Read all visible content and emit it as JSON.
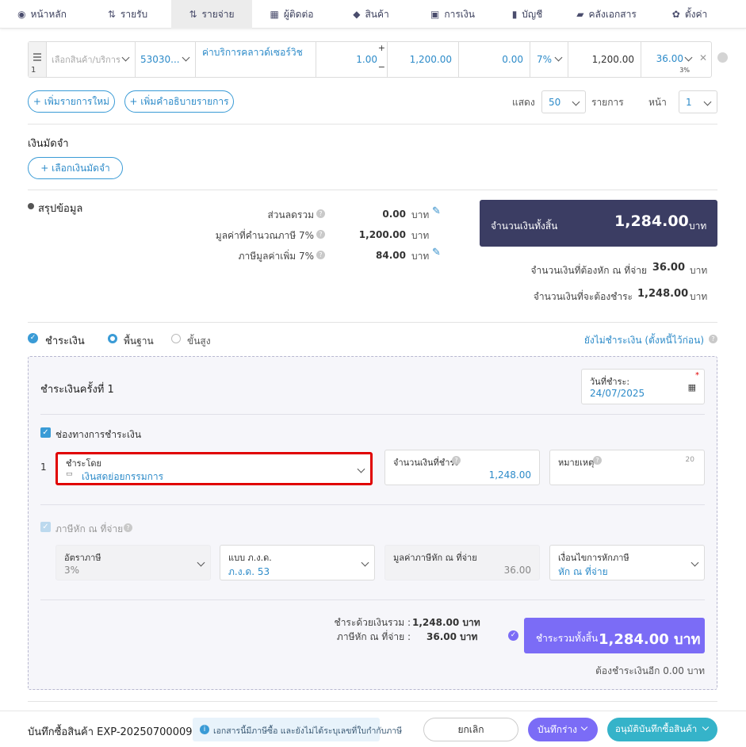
{
  "nav": [
    {
      "label": "หน้าหลัก",
      "icon": "dashboard-icon",
      "glyph": "◉"
    },
    {
      "label": "รายรับ",
      "icon": "income-icon",
      "glyph": "⇅"
    },
    {
      "label": "รายจ่าย",
      "icon": "expense-icon",
      "glyph": "⇅"
    },
    {
      "label": "ผู้ติดต่อ",
      "icon": "contacts-icon",
      "glyph": "▦"
    },
    {
      "label": "สินค้า",
      "icon": "product-icon",
      "glyph": "◆"
    },
    {
      "label": "การเงิน",
      "icon": "finance-icon",
      "glyph": "▣"
    },
    {
      "label": "บัญชี",
      "icon": "accounting-icon",
      "glyph": "▮"
    },
    {
      "label": "คลังเอกสาร",
      "icon": "folder-icon",
      "glyph": "▰"
    },
    {
      "label": "ตั้งค่า",
      "icon": "gear-icon",
      "glyph": "✿"
    }
  ],
  "line_item": {
    "row_no": "1",
    "product_placeholder": "เลือกสินค้า/บริการ",
    "account_code": "53030...",
    "description": "ค่าบริการคลาวด์เซอร์วิช",
    "quantity": "1.00",
    "unit_price": "1,200.00",
    "discount": "0.00",
    "vat": "7%",
    "amount": "1,200.00",
    "wht": "36.00",
    "wht_rate": "3%"
  },
  "buttons": {
    "add_item": "+ เพิ่มรายการใหม่",
    "add_description": "+ เพิ่มคำอธิบายรายการ",
    "select_deposit": "+ เลือกเงินมัดจำ"
  },
  "pagination": {
    "show_label": "แสดง",
    "per_page": "50",
    "items_label": "รายการ",
    "page_label": "หน้า",
    "page": "1"
  },
  "deposit": {
    "title": "เงินมัดจำ"
  },
  "summary": {
    "title": "สรุปข้อมูล",
    "discount_label": "ส่วนลดรวม",
    "discount_value": "0.00",
    "taxable_label": "มูลค่าที่คำนวณภาษี 7%",
    "taxable_value": "1,200.00",
    "vat_label": "ภาษีมูลค่าเพิ่ม 7%",
    "vat_value": "84.00",
    "currency": "บาท",
    "total_label": "จำนวนเงินทั้งสิ้น",
    "total_value": "1,284.00",
    "wht_label": "จำนวนเงินที่ต้องหัก ณ ที่จ่าย",
    "wht_value": "36.00",
    "payable_label": "จำนวนเงินที่จะต้องชำระ",
    "payable_value": "1,248.00"
  },
  "payment": {
    "title": "ชำระเงิน",
    "mode_basic": "พื้นฐาน",
    "mode_advanced": "ขั้นสูง",
    "unpaid_link": "ยังไม่ชำระเงิน (ตั้งหนี้ไว้ก่อน)",
    "installment_title": "ชำระเงินครั้งที่ 1",
    "date_label": "วันที่ชำระ:",
    "date_value": "24/07/2025",
    "channel_label": "ช่องทางการชำระเงิน",
    "channel_row": "1",
    "pay_by_label": "ชำระโดย",
    "pay_by_value": "เงินสดย่อยกรรมการ",
    "amount_label": "จำนวนเงินที่ชำระ",
    "amount_value": "1,248.00",
    "note_label": "หมายเหตุ",
    "note_count": "20",
    "wht_check_label": "ภาษีหัก ณ ที่จ่าย",
    "wht_rate_label": "อัตราภาษี",
    "wht_rate_value": "3%",
    "form_label": "แบบ ภ.ง.ด.",
    "form_value": "ภ.ง.ด. 53",
    "wht_amount_label": "มูลค่าภาษีหัก ณ ที่จ่าย",
    "wht_amount_value": "36.00",
    "condition_label": "เงื่อนไขการหักภาษี",
    "condition_value": "หัก ณ ที่จ่าย",
    "cash_total_label": "ชำระด้วยเงินรวม :",
    "cash_total_value": "1,248.00 บาท",
    "wht_total_label": "ภาษีหัก ณ ที่จ่าย :",
    "wht_total_value": "36.00 บาท",
    "grand_label": "ชำระรวมทั้งสิ้น",
    "grand_value": "1,284.00 บาท",
    "remaining": "ต้องชำระเงินอีก 0.00 บาท"
  },
  "footer": {
    "doc_title": "บันทึกซื้อสินค้า EXP-20250700009",
    "info": "เอกสารนี้มีภาษีซื้อ และยังไม่ได้ระบุเลขที่ใบกำกับภาษี",
    "cancel": "ยกเลิก",
    "save_draft": "บันทึกร่าง",
    "approve": "อนุมัติบันทึกซื้อสินค้า"
  },
  "colors": {
    "accent": "#3a9bd6",
    "dark_total": "#3b3d63",
    "purple": "#7b6cf6",
    "teal": "#35b3c9",
    "highlight": "#e00000"
  }
}
